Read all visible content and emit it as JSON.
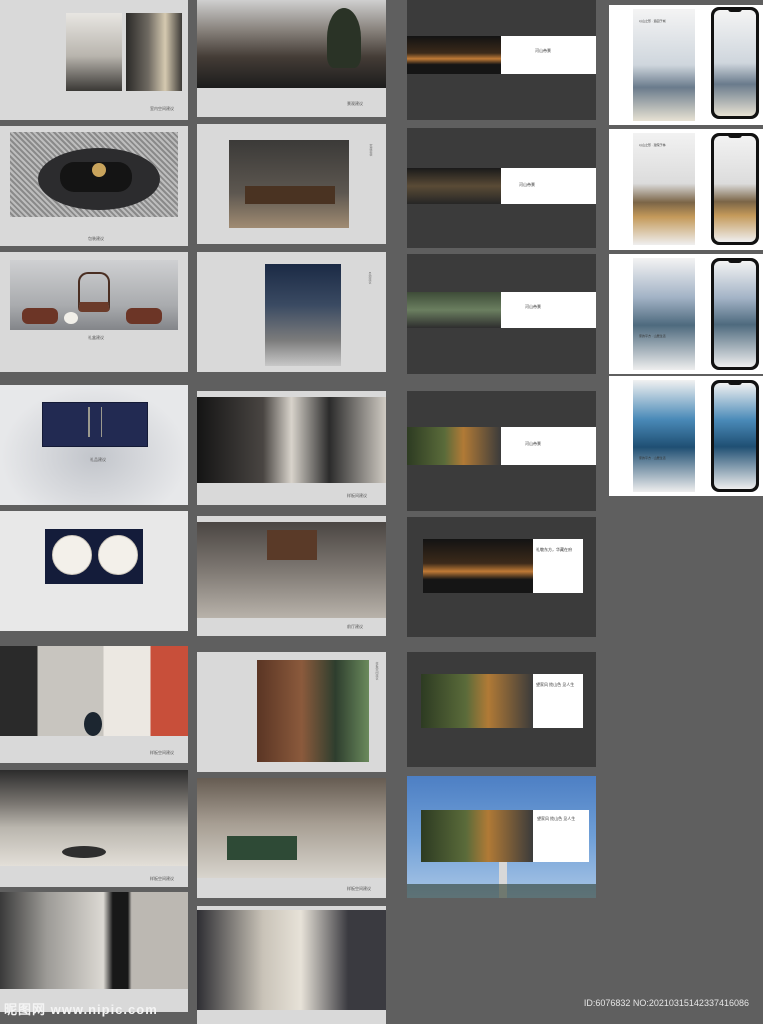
{
  "col1": {
    "captions": [
      "室内空间建议",
      "包装建议",
      "礼盒建议",
      "礼品建议",
      "样板空间建议",
      "样板空间建议"
    ]
  },
  "col2": {
    "captions": [
      "景观建议",
      "家居软装",
      "景观建议",
      "样板间建议",
      "前厅建议",
      "样板空间建议",
      "样板空间建议"
    ]
  },
  "col3": {
    "brand": "河山帝景",
    "slogan_a": "礼敬东方，华藏在府",
    "slogan_b": "望家风 揽山色 见人生",
    "slogan_c": "望家风 揽山色 见人生"
  },
  "col4": {
    "poster_titles": [
      "以山之形 · 造园于城",
      "以山之形 · 建院于林",
      "家的平方 · 山居生活",
      "家的平方 · 山居生活"
    ]
  },
  "watermark": "昵图网 www.nipic.com",
  "id_label": "ID:6076832 NO:20210315142337416086",
  "colors": {
    "background": "#5f5f5f",
    "card_light": "#d9d9d9",
    "card_dark": "#3b3b3b",
    "navy": "#222a52"
  }
}
